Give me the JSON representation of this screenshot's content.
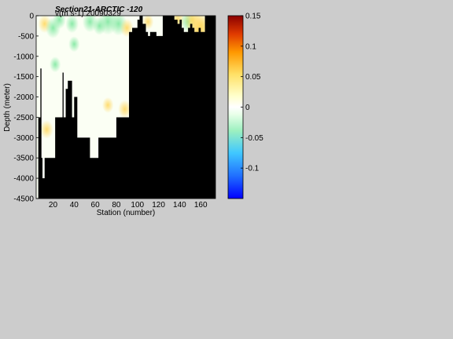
{
  "chart_data": {
    "type": "heatmap",
    "title": "Section21-ARCTIC -120",
    "subtitle": "v(m s-1)  20090329",
    "xlabel": "Station (number)",
    "ylabel": "Depth (meter)",
    "xlim": [
      4,
      174
    ],
    "ylim": [
      -4500,
      0
    ],
    "xticks": [
      20,
      40,
      60,
      80,
      100,
      120,
      140,
      160
    ],
    "yticks": [
      0,
      -500,
      -1000,
      -1500,
      -2000,
      -2500,
      -3000,
      -3500,
      -4000,
      -4500
    ],
    "colorbar": {
      "limits": [
        -0.15,
        0.15
      ],
      "ticks": [
        "0.15",
        "0.1",
        "0.05",
        "0",
        "-0.05",
        "-0.1"
      ],
      "tick_values": [
        0.15,
        0.1,
        0.05,
        0,
        -0.05,
        -0.1
      ]
    },
    "bottom_depth": {
      "station": [
        4,
        6,
        8,
        9,
        10,
        12,
        14,
        18,
        22,
        24,
        27,
        29,
        30,
        32,
        34,
        36,
        38,
        40,
        43,
        45,
        50,
        53,
        55,
        60,
        63,
        65,
        70,
        76,
        80,
        85,
        90,
        92,
        95,
        98,
        100,
        102,
        104,
        105,
        108,
        110,
        112,
        115,
        118,
        120,
        122,
        124,
        126,
        128,
        132,
        135,
        138,
        140,
        142,
        144,
        146,
        148,
        150,
        152,
        154,
        156,
        158,
        160,
        164,
        168,
        174
      ],
      "depth": [
        -4500,
        -2500,
        -1300,
        -3500,
        -4000,
        -3500,
        -3500,
        -3500,
        -2500,
        -2500,
        -2500,
        -1400,
        -2500,
        -1800,
        -1600,
        -1600,
        -2500,
        -2000,
        -3000,
        -3000,
        -3000,
        -3000,
        -3500,
        -3500,
        -3000,
        -3000,
        -3000,
        -3000,
        -2500,
        -2500,
        -2500,
        -400,
        -300,
        -300,
        -100,
        0,
        0,
        -200,
        -400,
        -500,
        -400,
        -400,
        -500,
        -500,
        -500,
        0,
        0,
        0,
        0,
        -100,
        -200,
        -100,
        -300,
        -400,
        -400,
        -300,
        -200,
        -300,
        -400,
        -400,
        -300,
        -400,
        0,
        0,
        0
      ]
    },
    "anomalies": [
      {
        "x": 12,
        "depth": -200,
        "value": 0.02
      },
      {
        "x": 20,
        "depth": -300,
        "value": -0.03
      },
      {
        "x": 26,
        "depth": -100,
        "value": -0.02
      },
      {
        "x": 38,
        "depth": -200,
        "value": -0.02
      },
      {
        "x": 40,
        "depth": -700,
        "value": -0.01
      },
      {
        "x": 55,
        "depth": -150,
        "value": -0.03
      },
      {
        "x": 64,
        "depth": -250,
        "value": -0.02
      },
      {
        "x": 72,
        "depth": -150,
        "value": -0.05
      },
      {
        "x": 82,
        "depth": -200,
        "value": -0.04
      },
      {
        "x": 90,
        "depth": -300,
        "value": 0.02
      },
      {
        "x": 110,
        "depth": -150,
        "value": 0.01
      },
      {
        "x": 138,
        "depth": -100,
        "value": 0.03
      },
      {
        "x": 148,
        "depth": -150,
        "value": -0.03
      },
      {
        "x": 152,
        "depth": -100,
        "value": 0.04
      },
      {
        "x": 158,
        "depth": -350,
        "value": 0.08
      },
      {
        "x": 160,
        "depth": -250,
        "value": 0.05
      },
      {
        "x": 14,
        "depth": -2800,
        "value": 0.02
      },
      {
        "x": 22,
        "depth": -1200,
        "value": -0.01
      },
      {
        "x": 72,
        "depth": -2200,
        "value": 0.01
      },
      {
        "x": 88,
        "depth": -2300,
        "value": 0.02
      }
    ]
  }
}
